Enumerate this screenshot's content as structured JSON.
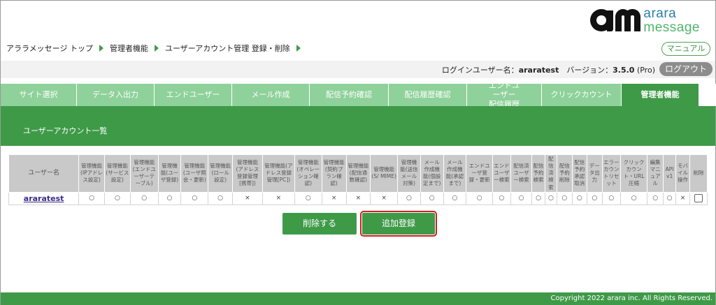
{
  "logo": {
    "line1": "arara",
    "line2": "message"
  },
  "breadcrumb": [
    "アララメッセージ トップ",
    "管理者機能",
    "ユーザーアカウント管理 登録・削除"
  ],
  "manual_label": "マニュアル",
  "userbar": {
    "login_label": "ログインユーザー名：",
    "username": "araratest",
    "version_label": "バージョン：",
    "version": "3.5.0",
    "edition": "(Pro)",
    "logout_label": "ログアウト"
  },
  "nav": {
    "tabs": [
      {
        "label": "サイト選択",
        "active": false
      },
      {
        "label": "データ入出力",
        "active": false
      },
      {
        "label": "エンドユーザー",
        "active": false
      },
      {
        "label": "メール作成",
        "active": false
      },
      {
        "label": "配信予約確認",
        "active": false
      },
      {
        "label": "配信履歴確認",
        "active": false
      },
      {
        "label": "エンドユーザー 配信履歴",
        "active": false
      },
      {
        "label": "クリックカウント",
        "active": false
      },
      {
        "label": "管理者機能",
        "active": true
      }
    ]
  },
  "section_title": "ユーザーアカウント一覧",
  "table": {
    "headers": [
      "ユーザー名",
      "管理機能 (IPアドレス設定)",
      "管理機能(サービス設定)",
      "管理機能 (エンドユーザーテーブル)",
      "管理機能(ユーザ登録)",
      "管理機能 (ユーザ照会・更新)",
      "管理機能 (ロール設定)",
      "管理機能 (アドレス登録管理 [携帯])",
      "管理機能(アドレス登録管理[PC])",
      "管理機能 (オペレーション確認)",
      "管理機能(契約プラン確認)",
      "管理機能(配信通数確認)",
      "管理機能 (S/ MIME)",
      "管理機能(送信メール対策)",
      "メール作成機能(個設定まで)",
      "メール作成機能(承認まで)",
      "エンドユーザ登録・更新",
      "エンドユーザー検索",
      "配信済ユーザー検索",
      "配信予約検索",
      "配信済検索",
      "配信予約削除",
      "配信予約承認取消",
      "データ出力",
      "エラーカウントリセット",
      "クリックカウント・URL圧縮",
      "編集マニュアル",
      "API v1",
      "モバイル操作",
      "削除"
    ],
    "rows": [
      {
        "user": "araratest",
        "cells": [
          "○",
          "○",
          "○",
          "○",
          "○",
          "○",
          "×",
          "×",
          "○",
          "×",
          "×",
          "×",
          "○",
          "○",
          "○",
          "○",
          "○",
          "○",
          "○",
          "○",
          "○",
          "○",
          "○",
          "○",
          "○",
          "○",
          "○",
          "×"
        ]
      }
    ]
  },
  "buttons": {
    "delete_label": "削除する",
    "add_label": "追加登録"
  },
  "footer": "Copyright 2022 arara inc. All Rights Reserved."
}
